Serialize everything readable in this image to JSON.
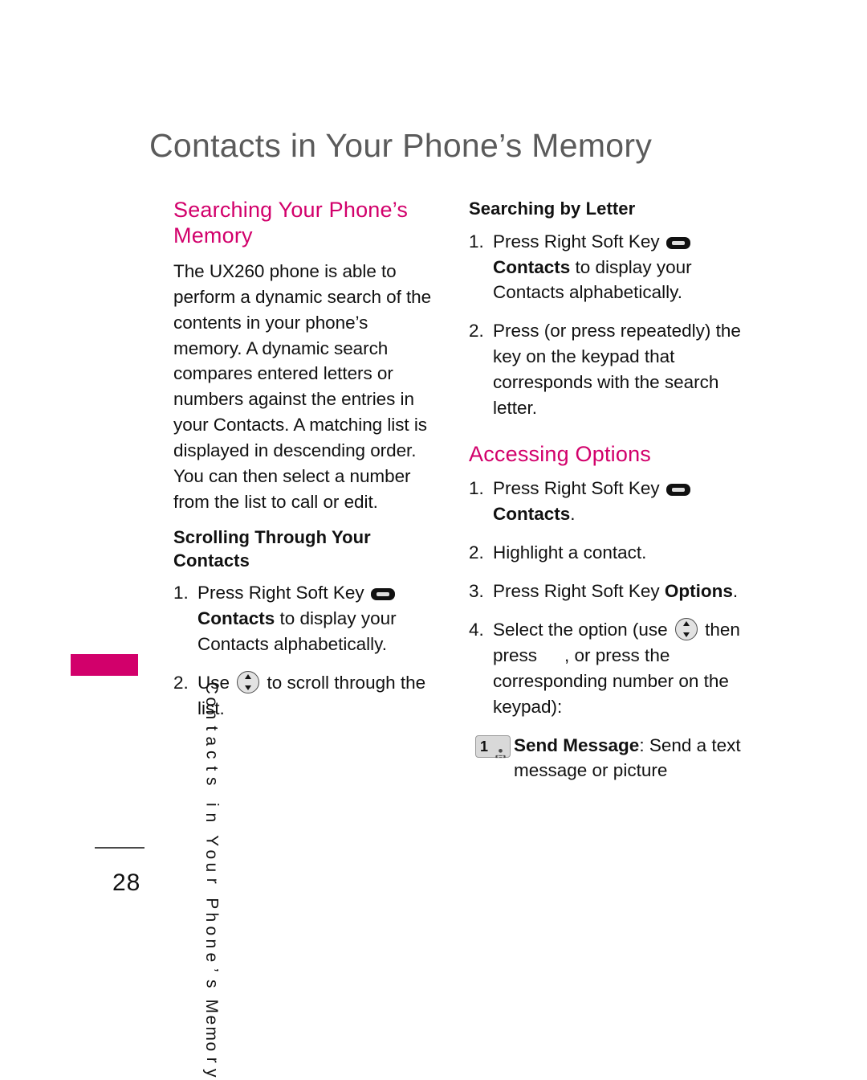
{
  "page": {
    "title": "Contacts in Your Phone’s Memory",
    "number": "28",
    "side_tab_label": "Contacts in Your Phone’s Memory",
    "accent_color": "#d2006b",
    "title_color": "#5b5b5b",
    "body_color": "#111111"
  },
  "left_column": {
    "heading": "Searching Your Phone’s Memory",
    "paragraph": "The UX260 phone is able to perform a dynamic search of the contents in your phone’s memory. A dynamic search compares entered letters or numbers against the entries in your Contacts. A matching list is displayed in descending order. You can then select a number from the list to call or edit.",
    "subheading": "Scrolling Through Your Contacts",
    "steps": [
      {
        "number": "1.",
        "text_before_icon": "Press Right Soft Key",
        "icon": "soft-key-icon",
        "bold_after_icon": "Contacts",
        "text_after_bold": " to display your Contacts alphabetically."
      },
      {
        "number": "2.",
        "text_before_icon": "Use",
        "icon": "navigation-key-icon",
        "text_after_icon": " to scroll through the list."
      }
    ]
  },
  "right_column": {
    "subheading": "Searching by Letter",
    "letter_steps": [
      {
        "number": "1.",
        "text_before_icon": "Press Right Soft Key",
        "icon": "soft-key-icon",
        "bold_after_icon": "Contacts",
        "text_after_bold": " to display your Contacts alphabetically."
      },
      {
        "number": "2.",
        "text": "Press (or press repeatedly) the key on the keypad that corresponds with the search letter."
      }
    ],
    "heading": "Accessing Options",
    "option_steps": [
      {
        "number": "1.",
        "text_before_icon": "Press Right Soft Key",
        "icon": "soft-key-icon",
        "bold_after_icon": "Contacts",
        "text_after_bold": "."
      },
      {
        "number": "2.",
        "text": "Highlight a contact."
      },
      {
        "number": "3.",
        "text_before_bold": "Press Right Soft Key ",
        "bold": "Options",
        "text_after_bold": "."
      },
      {
        "number": "4.",
        "text_before_icon": "Select the option (use",
        "icon": "navigation-key-icon",
        "text_middle": " then press",
        "icon2": "missing-key-icon",
        "text_after_icon2": ", or press the corresponding number on the keypad):"
      }
    ],
    "options": [
      {
        "key_number": "1",
        "key_glyph": "voicemail-icon",
        "label": "Send Message",
        "description": ": Send a text message or picture"
      }
    ]
  }
}
